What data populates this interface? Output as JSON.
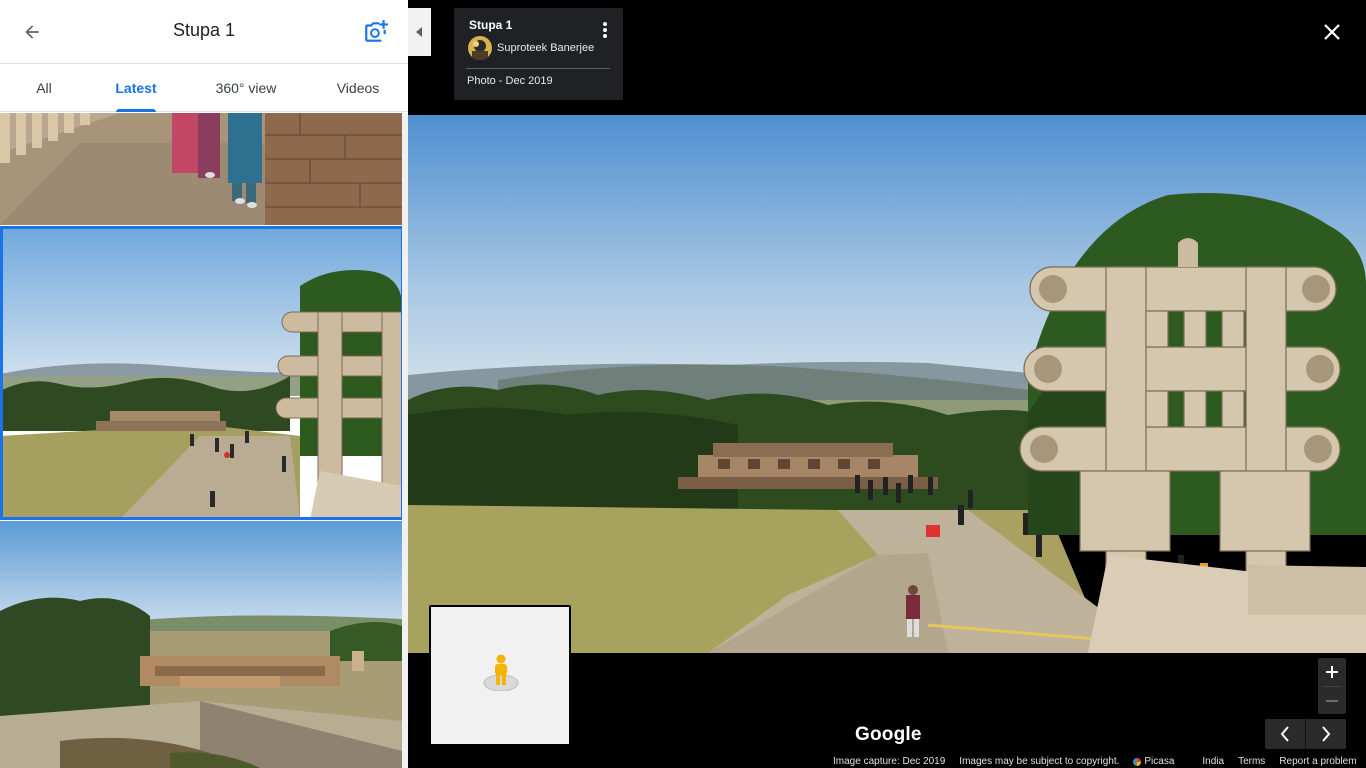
{
  "panel": {
    "title": "Stupa 1",
    "tabs": [
      {
        "label": "All"
      },
      {
        "label": "Latest"
      },
      {
        "label": "360° view"
      },
      {
        "label": "Videos"
      }
    ]
  },
  "info_card": {
    "title": "Stupa 1",
    "author": "Suproteek Banerjee",
    "date": "Photo - Dec 2019"
  },
  "footer": {
    "logo": "Google",
    "capture": "Image capture: Dec 2019",
    "copyright": "Images may be subject to copyright.",
    "picasa": "Picasa",
    "country": "India",
    "terms": "Terms",
    "report": "Report a problem"
  },
  "icons": {
    "back": "arrow-left-icon",
    "add_photo": "add-photo-camera-icon",
    "collapse": "caret-left-icon",
    "menu": "vertical-dots-icon",
    "close": "close-icon",
    "pegman": "pegman-icon",
    "zoom_in": "plus-icon",
    "zoom_out": "minus-icon",
    "prev": "chevron-left-icon",
    "next": "chevron-right-icon"
  },
  "colors": {
    "accent": "#1a73e8",
    "card_bg": "#202124",
    "viewer_bg": "#000000"
  }
}
